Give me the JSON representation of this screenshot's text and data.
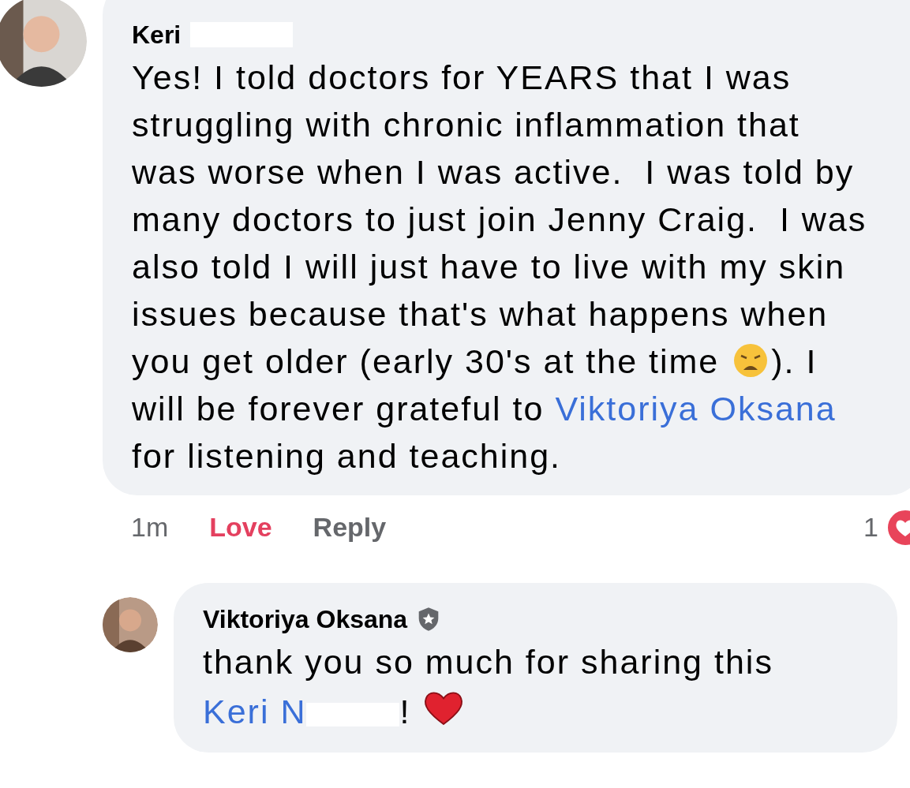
{
  "comments": [
    {
      "author": "Keri",
      "author_redacted": true,
      "admin_badge": false,
      "body": [
        {
          "kind": "text",
          "text": "Yes! I told doctors for YEARS that I was struggling with chronic inflammation that was worse when I was active.  I was told by many doctors to just join Jenny Craig.  I was also told I will just have to live with my skin issues because that's what happens when you get older (early 30's at the time "
        },
        {
          "kind": "weary-emoji"
        },
        {
          "kind": "text",
          "text": "). I will be forever grateful to "
        },
        {
          "kind": "link",
          "text": "Viktoriya Oksana"
        },
        {
          "kind": "text",
          "text": " for listening and teaching."
        }
      ],
      "time": "1m",
      "actions": [
        {
          "label": "Love",
          "selected": true
        },
        {
          "label": "Reply",
          "selected": false
        }
      ],
      "reaction_count": "1"
    },
    {
      "author": "Viktoriya Oksana",
      "author_redacted": false,
      "admin_badge": true,
      "body": [
        {
          "kind": "text",
          "text": "thank you so much for sharing this "
        },
        {
          "kind": "link",
          "text": "Keri N"
        },
        {
          "kind": "redacted"
        },
        {
          "kind": "text",
          "text": "! "
        },
        {
          "kind": "heart-emoji"
        }
      ]
    }
  ]
}
